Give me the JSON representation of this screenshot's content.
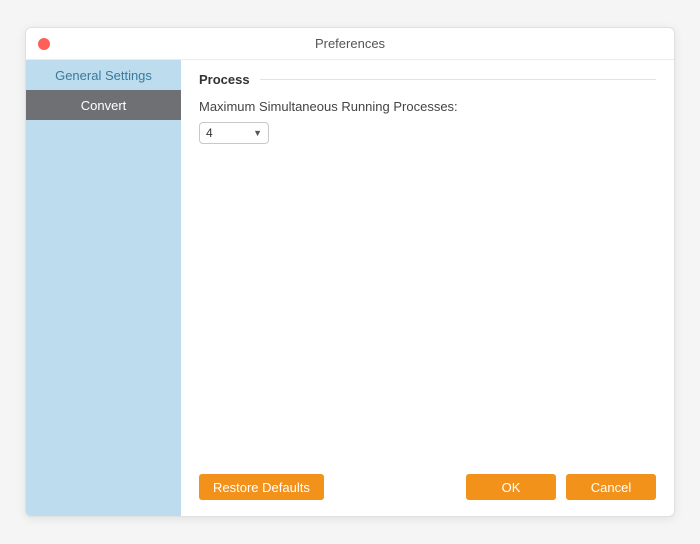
{
  "window": {
    "title": "Preferences"
  },
  "sidebar": {
    "items": [
      {
        "label": "General Settings"
      },
      {
        "label": "Convert"
      }
    ]
  },
  "main": {
    "section_title": "Process",
    "max_processes_label": "Maximum Simultaneous Running Processes:",
    "max_processes_value": "4"
  },
  "buttons": {
    "restore": "Restore Defaults",
    "ok": "OK",
    "cancel": "Cancel"
  }
}
